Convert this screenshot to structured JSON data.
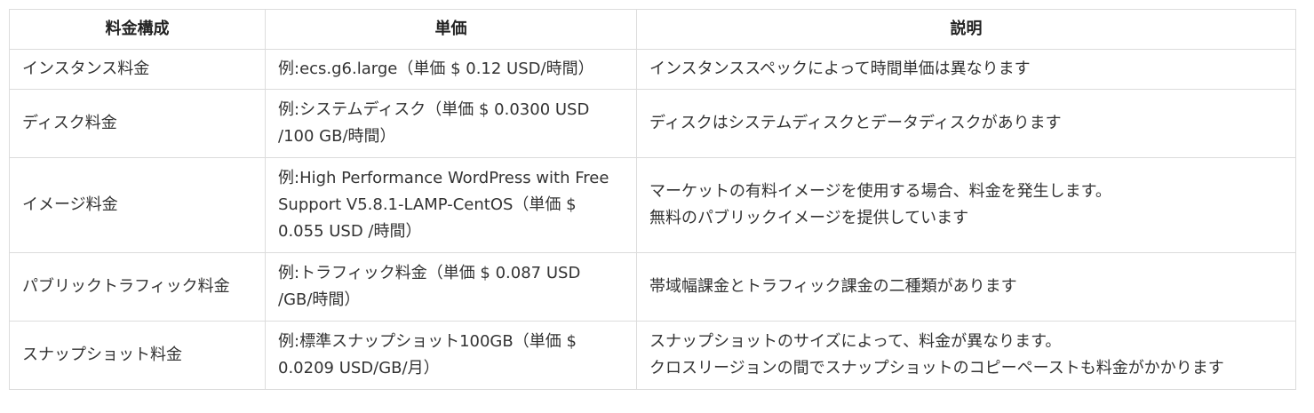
{
  "table": {
    "headers": [
      "料金構成",
      "単価",
      "説明"
    ],
    "rows": [
      {
        "component": "インスタンス料金",
        "price": "例:ecs.g6.large（単価 $ 0.12 USD/時間）",
        "description": "インスタンススペックによって時間単価は異なります"
      },
      {
        "component": "ディスク料金",
        "price": "例:システムディスク（単価 $ 0.0300 USD /100 GB/時間）",
        "description": "ディスクはシステムディスクとデータディスクがあります"
      },
      {
        "component": "イメージ料金",
        "price": "例:High Performance WordPress with Free Support V5.8.1-LAMP-CentOS（単価 $ 0.055 USD /時間）",
        "description_lines": [
          "マーケットの有料イメージを使用する場合、料金を発生します。",
          "無料のパブリックイメージを提供しています"
        ]
      },
      {
        "component": "パブリックトラフィック料金",
        "price": "例:トラフィック料金（単価 $ 0.087 USD /GB/時間）",
        "description": "帯域幅課金とトラフィック課金の二種類があります"
      },
      {
        "component": "スナップショット料金",
        "price": "例:標準スナップショット100GB（単価 $ 0.0209 USD/GB/月）",
        "description_lines": [
          "スナップショットのサイズによって、料金が異なります。",
          "クロスリージョンの間でスナップショットのコピーペーストも料金がかかります"
        ]
      }
    ]
  }
}
